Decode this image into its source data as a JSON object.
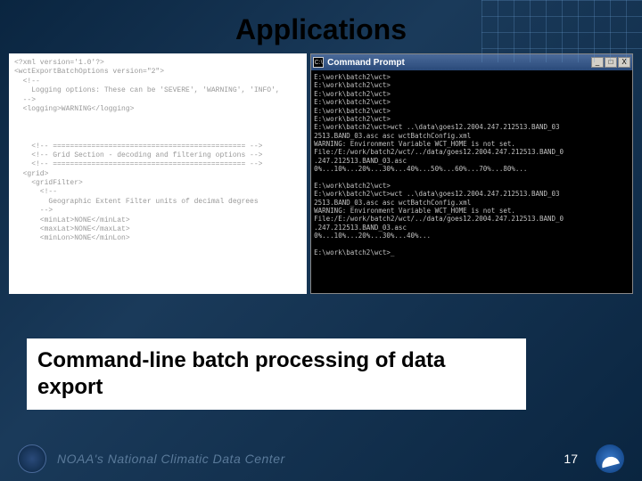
{
  "title": "Applications",
  "xml_content": "<?xml version='1.0'?>\n<wctExportBatchOptions version=\"2\">\n  <!--\n    Logging options: These can be 'SEVERE', 'WARNING', 'INFO',\n  -->\n  <logging>WARNING</logging>\n\n\n\n    <!-- ============================================= -->\n    <!-- Grid Section - decoding and filtering options -->\n    <!-- ============================================= -->\n  <grid>\n    <gridFilter>\n      <!--\n        Geographic Extent Filter units of decimal degrees\n      -->\n      <minLat>NONE</minLat>\n      <maxLat>NONE</maxLat>\n      <minLon>NONE</minLon>",
  "cmd": {
    "icon_label": "C:\\",
    "title": "Command Prompt",
    "buttons": {
      "min": "_",
      "max": "□",
      "close": "X"
    },
    "output": "E:\\work\\batch2\\wct>\nE:\\work\\batch2\\wct>\nE:\\work\\batch2\\wct>\nE:\\work\\batch2\\wct>\nE:\\work\\batch2\\wct>\nE:\\work\\batch2\\wct>\nE:\\work\\batch2\\wct>wct ..\\data\\goes12.2004.247.212513.BAND_03\n2513.BAND_03.asc asc wctBatchConfig.xml\nWARNING: Environment Variable WCT_HOME is not set.\nFile:/E:/work/batch2/wct/../data/goes12.2004.247.212513.BAND_0\n.247.212513.BAND_03.asc\n0%...10%...20%...30%...40%...50%...60%...70%...80%...\n\nE:\\work\\batch2\\wct>\nE:\\work\\batch2\\wct>wct ..\\data\\goes12.2004.247.212513.BAND_03\n2513.BAND_03.asc asc wctBatchConfig.xml\nWARNING: Environment Variable WCT_HOME is not set.\nFile:/E:/work/batch2/wct/../data/goes12.2004.247.212513.BAND_0\n.247.212513.BAND_03.asc\n0%...10%...20%...30%...40%...\n\nE:\\work\\batch2\\wct>_"
  },
  "caption": "Command-line batch processing of data export",
  "footer_text": "NOAA's National Climatic Data Center",
  "page_number": "17"
}
